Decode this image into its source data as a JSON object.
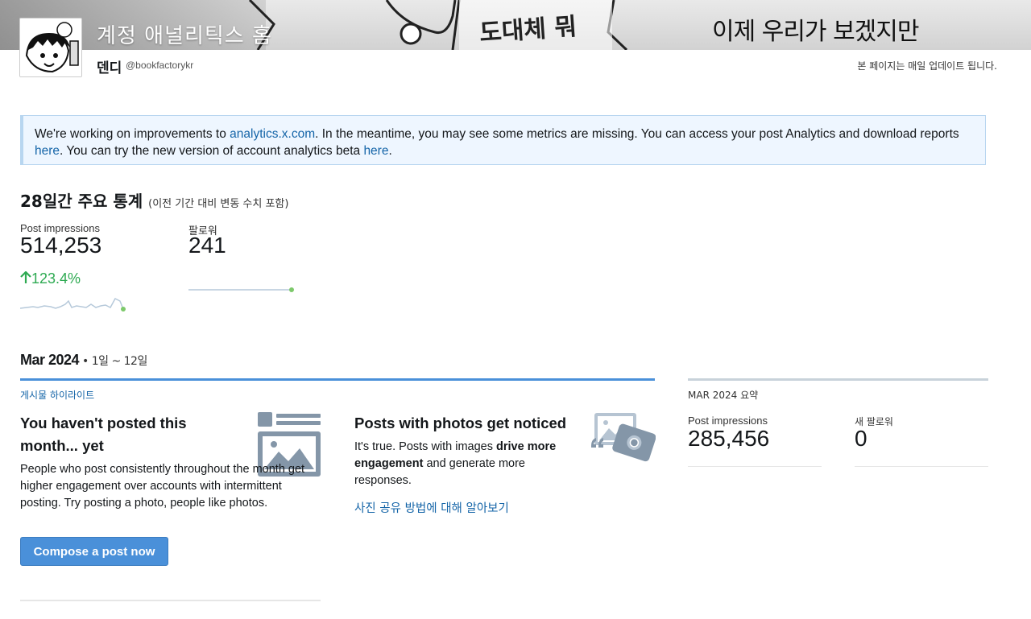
{
  "header": {
    "title": "계정 애널리틱스 홈",
    "banner_comic_text": "이제 우리가 보겠지만",
    "banner_comic_text_left": "도대체 뭐",
    "user_name": "덴디",
    "user_handle": "@bookfactorykr",
    "update_note": "본 페이지는 매일 업데이트 됩니다."
  },
  "notice": {
    "text_1": "We're working on improvements to ",
    "link_1": "analytics.x.com",
    "text_2": ". In the meantime, you may see some metrics are missing. You can access your post Analytics and download reports ",
    "link_2": "here",
    "text_3": ". You can try the new version of account analytics beta ",
    "link_3": "here",
    "text_4": "."
  },
  "summary_28d": {
    "title": "28일간 주요 통계",
    "subtitle": "(이전 기간 대비 변동 수치 포함)",
    "impressions_label": "Post impressions",
    "impressions_value": "514,253",
    "impressions_change": "123.4%",
    "followers_label": "팔로워",
    "followers_value": "241"
  },
  "month": {
    "title": "Mar 2024",
    "range": " • 1일 ~ 12일",
    "highlights_label": "게시물 하이라이트",
    "card1": {
      "title": "You haven't posted this month... yet",
      "body": "People who post consistently throughout the month get higher engagement over accounts with intermittent posting. Try posting a photo, people like photos.",
      "button": "Compose a post now"
    },
    "card2": {
      "title": "Posts with photos get noticed",
      "body_1": "It's true. Posts with images ",
      "body_bold": "drive more engagement",
      "body_2": " and generate more responses.",
      "link": "사진 공유 방법에 대해 알아보기"
    },
    "summary": {
      "label": "MAR 2024 요약",
      "impressions_label": "Post impressions",
      "impressions_value": "285,456",
      "followers_label": "새 팔로워",
      "followers_value": "0"
    }
  },
  "colors": {
    "accent": "#4a90d9",
    "link": "#1565a8",
    "positive": "#2eaa52",
    "notice_bg": "#eef6ff"
  },
  "icons": [
    "arrow-up-icon",
    "post-layout-icon",
    "photo-stack-icon"
  ]
}
